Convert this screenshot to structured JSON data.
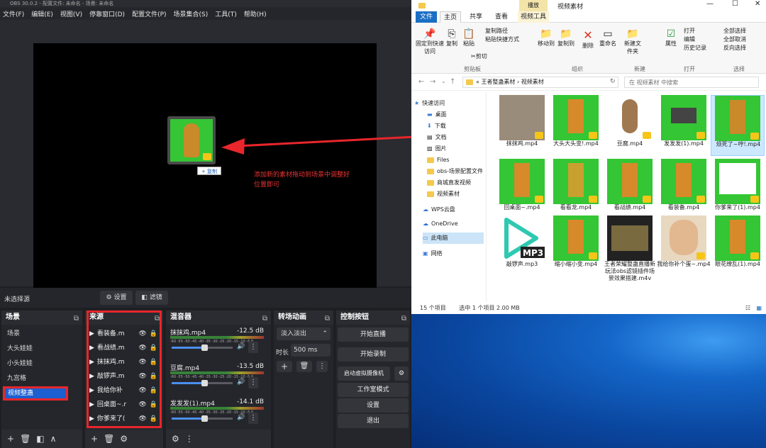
{
  "obs": {
    "title": "OBS 30.0.2 - 配置文件: 未命名 - 场景: 未命名",
    "menu": [
      "文件(F)",
      "编辑(E)",
      "视图(V)",
      "停靠窗口(D)",
      "配置文件(P)",
      "场景集合(S)",
      "工具(T)",
      "帮助(H)"
    ],
    "copy_tip": "+ 复制",
    "annotation": "添加新的素材拖动到场景中调整好位置即可",
    "status_label": "未选择源",
    "settings_btn": "设置",
    "filter_btn": "滤镜",
    "scenes": {
      "title": "场景",
      "items": [
        "场景",
        "大头娃娃",
        "小头娃娃",
        "九宫格",
        "视频整蛊"
      ]
    },
    "sources": {
      "title": "来源",
      "items": [
        "看装备.m",
        "看战绩.m",
        "抹抹鸡.m",
        "敲锣声.m",
        "我给你补",
        "回桌面~.r",
        "你爹来了("
      ]
    },
    "mixer": {
      "title": "混音器",
      "tracks": [
        {
          "name": "抹抹鸡.mp4",
          "db": "-12.5 dB"
        },
        {
          "name": "豆腐.mp4",
          "db": "-13.5 dB"
        },
        {
          "name": "发发发(1).mp4",
          "db": "-14.1 dB"
        }
      ],
      "scale": "-60 -55 -50 -45 -40 -35 -30 -25 -20 -15 -10 -5 0"
    },
    "transitions": {
      "title": "转场动画",
      "type": "淡入淡出",
      "duration_label": "时长",
      "duration": "500 ms"
    },
    "controls": {
      "title": "控制按钮",
      "buttons": [
        "开始直播",
        "开始录制",
        "启动虚拟摄像机",
        "工作室模式",
        "设置",
        "退出"
      ]
    }
  },
  "explorer": {
    "title": "视频素材",
    "ctx_tab": "播放",
    "tabs": [
      "文件",
      "主页",
      "共享",
      "查看",
      "视频工具"
    ],
    "ribbon": {
      "pin": "固定到快速访问",
      "copy": "复制",
      "paste": "粘贴",
      "copy_path": "复制路径",
      "paste_shortcut": "粘贴快捷方式",
      "cut": "剪切",
      "move_to": "移动到",
      "copy_to": "复制到",
      "delete": "删除",
      "rename": "重命名",
      "new_folder": "新建文件夹",
      "properties": "属性",
      "open": "打开",
      "edit": "编辑",
      "history": "历史记录",
      "select_all": "全部选择",
      "select_none": "全部取消",
      "invert": "反向选择",
      "groups": [
        "剪贴板",
        "组织",
        "新建",
        "打开",
        "选择"
      ]
    },
    "address": "« 王者整蛊素材 › 视频素材",
    "search_placeholder": "在 视频素材 中搜索",
    "nav": [
      "快速访问",
      "桌面",
      "下载",
      "文档",
      "图片",
      "Files",
      "obs-场景配置文件",
      "商城直发视频",
      "视频素材",
      "WPS云盘",
      "OneDrive",
      "此电脑",
      "网络"
    ],
    "files": [
      "抹抹鸡.mp4",
      "大头大头变!.mp4",
      "豆腐.mp4",
      "发发发(1).mp4",
      "烦死了~哼!.mp4",
      "回桌面~.mp4",
      "看看龙.mp4",
      "看战绩.mp4",
      "看装备.mp4",
      "你爹来了(1).mp4",
      "敲锣声.mp3",
      "缩小缩小变.mp4",
      "王者荣耀整蛊直播新玩法obs滤镜插件场景效果搭建.m4v",
      "我给你补个蛋~.mp4",
      "眼花缭乱(1).mp4"
    ],
    "status_count": "15 个项目",
    "status_selected": "选中 1 个项目  2.00 MB"
  },
  "colors": {
    "obs_bg": "#1e1f23",
    "accent_red": "#e8262b",
    "explorer_blue": "#1a6fc4",
    "green_screen": "#34c634"
  }
}
